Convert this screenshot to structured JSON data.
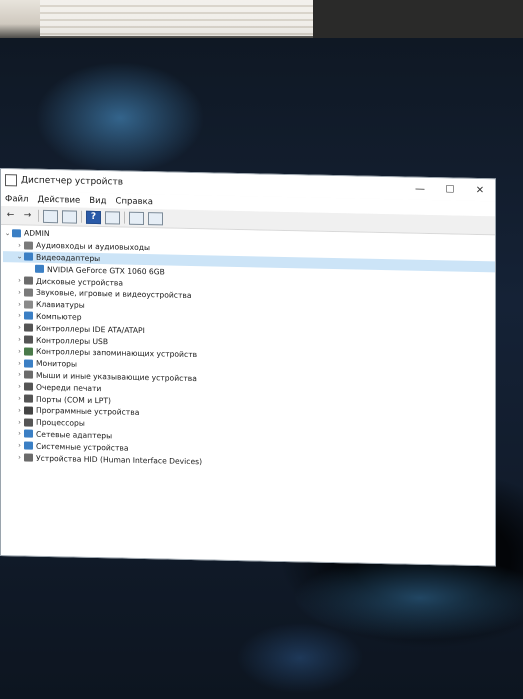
{
  "window": {
    "title": "Диспетчер устройств",
    "controls": [
      "—",
      "☐",
      "✕"
    ]
  },
  "menu": [
    "Файл",
    "Действие",
    "Вид",
    "Справка"
  ],
  "toolbar": {
    "back": "←",
    "forward": "→",
    "help": "?"
  },
  "tree": {
    "root": {
      "label": "ADMIN",
      "expanded": true
    },
    "items": [
      {
        "label": "Аудиовходы и аудиовыходы",
        "expanded": false,
        "color": "#7a7a7a"
      },
      {
        "label": "Видеоадаптеры",
        "expanded": true,
        "selected": true,
        "color": "#3b7fc4",
        "children": [
          {
            "label": "NVIDIA GeForce GTX 1060 6GB",
            "color": "#3b7fc4"
          }
        ]
      },
      {
        "label": "Дисковые устройства",
        "expanded": false,
        "color": "#6b6b6b"
      },
      {
        "label": "Звуковые, игровые и видеоустройства",
        "expanded": false,
        "color": "#7a7a7a"
      },
      {
        "label": "Клавиатуры",
        "expanded": false,
        "color": "#8a8a8a"
      },
      {
        "label": "Компьютер",
        "expanded": false,
        "color": "#3b7fc4"
      },
      {
        "label": "Контроллеры IDE ATA/ATAPI",
        "expanded": false,
        "color": "#555555"
      },
      {
        "label": "Контроллеры USB",
        "expanded": false,
        "color": "#555555"
      },
      {
        "label": "Контроллеры запоминающих устройств",
        "expanded": false,
        "color": "#4a7a4a"
      },
      {
        "label": "Мониторы",
        "expanded": false,
        "color": "#3b7fc4"
      },
      {
        "label": "Мыши и иные указывающие устройства",
        "expanded": false,
        "color": "#6b6b6b"
      },
      {
        "label": "Очереди печати",
        "expanded": false,
        "color": "#555555"
      },
      {
        "label": "Порты (COM и LPT)",
        "expanded": false,
        "color": "#555555"
      },
      {
        "label": "Программные устройства",
        "expanded": false,
        "color": "#444444"
      },
      {
        "label": "Процессоры",
        "expanded": false,
        "color": "#555555"
      },
      {
        "label": "Сетевые адаптеры",
        "expanded": false,
        "color": "#3b7fc4"
      },
      {
        "label": "Системные устройства",
        "expanded": false,
        "color": "#3b7fc4"
      },
      {
        "label": "Устройства HID (Human Interface Devices)",
        "expanded": false,
        "color": "#6b6b6b"
      }
    ]
  }
}
